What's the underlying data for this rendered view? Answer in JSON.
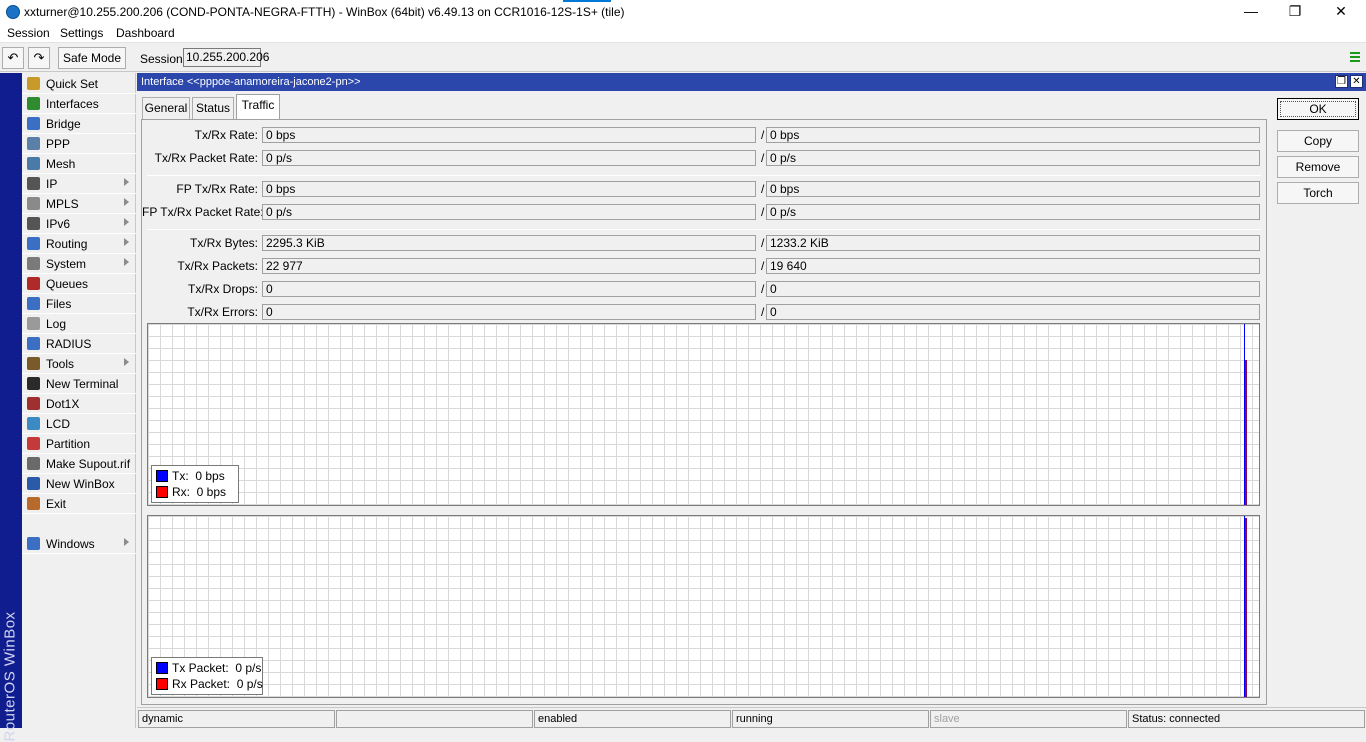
{
  "window": {
    "title": "xxturner@10.255.200.206 (COND-PONTA-NEGRA-FTTH) - WinBox (64bit) v6.49.13 on CCR1016-12S-1S+ (tile)",
    "minimize_glyph": "—",
    "maximize_glyph": "❐",
    "close_glyph": "✕"
  },
  "menu": [
    "Session",
    "Settings",
    "Dashboard"
  ],
  "toolbar": {
    "undo_glyph": "↶",
    "redo_glyph": "↷",
    "safe_mode_label": "Safe Mode",
    "session_label": "Session:",
    "session_value": "10.255.200.206"
  },
  "brand": "RouterOS WinBox",
  "sidebar": {
    "items": [
      {
        "label": "Quick Set",
        "icon": "quick-set-icon",
        "color": "#c89a2a",
        "arrow": false
      },
      {
        "label": "Interfaces",
        "icon": "interfaces-icon",
        "color": "#2e8b2e",
        "arrow": false
      },
      {
        "label": "Bridge",
        "icon": "bridge-icon",
        "color": "#3a6fc4",
        "arrow": false
      },
      {
        "label": "PPP",
        "icon": "ppp-icon",
        "color": "#5a7fa8",
        "arrow": false
      },
      {
        "label": "Mesh",
        "icon": "mesh-icon",
        "color": "#4a7aa8",
        "arrow": false
      },
      {
        "label": "IP",
        "icon": "ip-icon",
        "color": "#555555",
        "arrow": true
      },
      {
        "label": "MPLS",
        "icon": "mpls-icon",
        "color": "#8a8a8a",
        "arrow": true
      },
      {
        "label": "IPv6",
        "icon": "ipv6-icon",
        "color": "#555555",
        "arrow": true
      },
      {
        "label": "Routing",
        "icon": "routing-icon",
        "color": "#3a6fc4",
        "arrow": true
      },
      {
        "label": "System",
        "icon": "system-gear-icon",
        "color": "#7a7a7a",
        "arrow": true
      },
      {
        "label": "Queues",
        "icon": "queues-icon",
        "color": "#b02a2a",
        "arrow": false
      },
      {
        "label": "Files",
        "icon": "files-icon",
        "color": "#3a6fc4",
        "arrow": false
      },
      {
        "label": "Log",
        "icon": "log-icon",
        "color": "#9a9a9a",
        "arrow": false
      },
      {
        "label": "RADIUS",
        "icon": "radius-icon",
        "color": "#3a6fc4",
        "arrow": false
      },
      {
        "label": "Tools",
        "icon": "tools-icon",
        "color": "#7a5a2a",
        "arrow": true
      },
      {
        "label": "New Terminal",
        "icon": "terminal-icon",
        "color": "#2a2a2a",
        "arrow": false
      },
      {
        "label": "Dot1X",
        "icon": "dot1x-icon",
        "color": "#a03030",
        "arrow": false
      },
      {
        "label": "LCD",
        "icon": "lcd-icon",
        "color": "#3a8ac4",
        "arrow": false
      },
      {
        "label": "Partition",
        "icon": "partition-icon",
        "color": "#c43a3a",
        "arrow": false
      },
      {
        "label": "Make Supout.rif",
        "icon": "supout-icon",
        "color": "#6a6a6a",
        "arrow": false
      },
      {
        "label": "New WinBox",
        "icon": "winbox-icon",
        "color": "#2a5aa8",
        "arrow": false
      },
      {
        "label": "Exit",
        "icon": "exit-icon",
        "color": "#b86a2a",
        "arrow": false
      }
    ],
    "windows": {
      "label": "Windows",
      "icon": "windows-icon",
      "color": "#3a6fc4",
      "arrow": true
    }
  },
  "iface_window": {
    "title": "Interface <<pppoe-anamoreira-jacone2-pn>>",
    "restore_glyph": "❐",
    "close_glyph": "✕",
    "tabs": [
      "General",
      "Status",
      "Traffic"
    ],
    "active_tab": "Traffic",
    "rows": [
      {
        "label": "Tx/Rx Rate:",
        "tx": "0 bps",
        "rx": "0 bps"
      },
      {
        "label": "Tx/Rx Packet Rate:",
        "tx": "0 p/s",
        "rx": "0 p/s"
      },
      {
        "label": "FP Tx/Rx Rate:",
        "tx": "0 bps",
        "rx": "0 bps"
      },
      {
        "label": "FP Tx/Rx Packet Rate:",
        "tx": "0 p/s",
        "rx": "0 p/s"
      },
      {
        "label": "Tx/Rx Bytes:",
        "tx": "2295.3 KiB",
        "rx": "1233.2 KiB"
      },
      {
        "label": "Tx/Rx Packets:",
        "tx": "22 977",
        "rx": "19 640"
      },
      {
        "label": "Tx/Rx Drops:",
        "tx": "0",
        "rx": "0"
      },
      {
        "label": "Tx/Rx Errors:",
        "tx": "0",
        "rx": "0"
      }
    ],
    "slash": "/",
    "graph_rate": {
      "legend": [
        {
          "label": "Tx:",
          "value": "0 bps",
          "color": "#0000ff"
        },
        {
          "label": "Rx:",
          "value": "0 bps",
          "color": "#ff0000"
        }
      ]
    },
    "graph_packets": {
      "legend": [
        {
          "label": "Tx Packet:",
          "value": "0 p/s",
          "color": "#0000ff"
        },
        {
          "label": "Rx Packet:",
          "value": "0 p/s",
          "color": "#ff0000"
        }
      ]
    },
    "buttons": [
      "OK",
      "Copy",
      "Remove",
      "Torch"
    ]
  },
  "status": [
    "dynamic",
    "",
    "enabled",
    "running",
    "slave",
    "Status: connected"
  ],
  "colors": {
    "brand_strip": "#0f1d8e",
    "window_title": "#2b47ac",
    "tx": "#0000ff",
    "rx": "#ff0000"
  }
}
